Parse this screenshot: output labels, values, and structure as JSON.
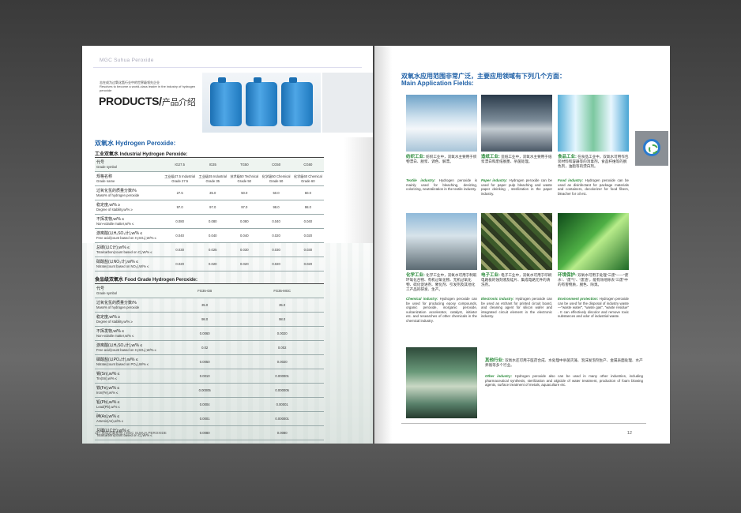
{
  "left_page": {
    "brand": "MGC Suhua Peroxide",
    "tagline_cn": "志在成为过氧化氢行业中的世界级领先企业",
    "tagline_en": "Resolves to become a world-class leader in the industry of hydrogen peroxide",
    "products_en": "PRODUCTS",
    "products_cn": "产品介绍",
    "heading": "双氧水 Hydrogen Peroxide:",
    "industrial_heading": "工业双氧水 Industrial Hydrogen Peroxide:",
    "food_heading": "食品级双氧水 Food Grade Hydrogen Peroxide:",
    "industrial_table": {
      "header_row1": {
        "cn": "代号",
        "en": "Grade symbol",
        "cells": [
          "IG27.5",
          "IG35",
          "TG50",
          "CG50",
          "CG60"
        ]
      },
      "header_row2": {
        "cn": "规格名称",
        "en": "Grade name",
        "cells": [
          "工业级27.5 Industrial Grade 27.5",
          "工业级35 Industrial Grade 35",
          "技术级50 Technical Grade 50",
          "化学级50 Chemical Grade 50",
          "化学级60 Chemical Grade 60"
        ]
      },
      "rows": [
        {
          "cn": "过氧化氢的质量分数/%",
          "en": "Mass% of hydrogen peroxide",
          "cells": [
            "27.5",
            "35.0",
            "50.0",
            "50.0",
            "60.0"
          ]
        },
        {
          "cn": "稳定度,w/% ≥",
          "en": "Degree of stability,w/% ≥",
          "cells": [
            "97.0",
            "97.0",
            "97.0",
            "98.0",
            "98.0"
          ]
        },
        {
          "cn": "不挥发物,w/% ≤",
          "en": "Non-volatile matter,w/% ≤",
          "cells": [
            "0.080",
            "0.080",
            "0.080",
            "0.040",
            "0.040"
          ]
        },
        {
          "cn": "游离酸(以H₂SO₄计),w/% ≤",
          "en": "Free acid(count based on H₂SO₄),W/% ≤",
          "cells": [
            "0.040",
            "0.040",
            "0.040",
            "0.020",
            "0.020"
          ]
        },
        {
          "cn": "总碳(以C计),w/% ≤",
          "en": "Totalcarbon(count based on C),W/% ≤",
          "cells": [
            "0.030",
            "0.025",
            "0.030",
            "0.030",
            "0.030"
          ]
        },
        {
          "cn": "硝酸盐(以NO₃计),w/% ≤",
          "en": "Nitrate(count based on NO₃),W/% ≤",
          "cells": [
            "0.020",
            "0.020",
            "0.020",
            "0.020",
            "0.020"
          ]
        }
      ]
    },
    "food_table": {
      "header": {
        "cn": "代号",
        "en": "Grade symbol",
        "cells": [
          "FG35-GB",
          "FG35-MGC"
        ]
      },
      "rows": [
        {
          "cn": "过氧化氢的质量分数/%",
          "en": "Mass% of hydrogen peroxide",
          "cells": [
            "35.0",
            "35.0"
          ]
        },
        {
          "cn": "稳定度,w/% ≥",
          "en": "Degree of stability,w/% ≥",
          "cells": [
            "98.0",
            "98.0"
          ]
        },
        {
          "cn": "不挥发物,w/% ≤",
          "en": "Non-volatile matter,w/% ≤",
          "cells": [
            "0.0060",
            "0.0020"
          ]
        },
        {
          "cn": "游离酸(以H₂SO₄计),w/% ≤",
          "en": "Free acid(count based on H₂SO₄),W/% ≤",
          "cells": [
            "0.02",
            "0.002"
          ]
        },
        {
          "cn": "磷酸盐(以PO₄计),w/% ≤",
          "en": "Nitrate(count based on PO₄),W/% ≤",
          "cells": [
            "0.0050",
            "0.0020"
          ]
        },
        {
          "cn": "锡(Sn),w/% ≤",
          "en": "Tin(Sn),w/% ≤",
          "cells": [
            "0.0010",
            "0.000001"
          ]
        },
        {
          "cn": "铁(Fe),w/% ≤",
          "en": "Iron(Fe),w/% ≤",
          "cells": [
            "0.00005",
            "0.000005"
          ]
        },
        {
          "cn": "铅(Pb),w/% ≤",
          "en": "Lead(Pb),w/% ≤",
          "cells": [
            "0.0004",
            "0.00001"
          ]
        },
        {
          "cn": "砷(As),w/% ≤",
          "en": "Arsenic(As),w/% ≤",
          "cells": [
            "0.0001",
            "0.000001"
          ]
        },
        {
          "cn": "总碳(以C计),w/% ≤",
          "en": "Totalcarbon(count based on C),W/% ≤",
          "cells": [
            "0.0080",
            "0.0080"
          ]
        }
      ]
    },
    "page_number": "11",
    "footer": "| 苏华过氧化物 | MGC SUHUA PEROXIDE"
  },
  "right_page": {
    "title_cn": "双氧水应用范围非常广泛，主要应用领域有下列几个方面：",
    "title_en": "Main Application Fields:",
    "apps": [
      {
        "head": "纺织工业:",
        "cn": "纺织工业中，双氧水主要用于织物漂白、脱浆、调色、解漂。",
        "en_head": "Textile industry:",
        "en": "Hydrogen peroxide is mainly used for bleaching, desizing, colorizing, neutralization in the textile industry."
      },
      {
        "head": "造纸工业:",
        "cn": "造纸工业中，双氧水主要用于纸浆漂白和废纸脱墨、杀菌处理。",
        "en_head": "Paper industry:",
        "en": "Hydrogen peroxide can be used for paper pulp bleaching and waste paper deinking , sterilization in the paper industry."
      },
      {
        "head": "食品工业:",
        "cn": "在食品工业中，双氧水可用作包装材料和容器等的消毒剂，食品杆维等的脱色剂，油脂等的漂白剂。",
        "en_head": "Food industry:",
        "en": "Hydrogen peroxide can be used as disinfectant for package materials and containers, decolorizer for food fibers, bleacher for oil etc."
      },
      {
        "head": "化学工业:",
        "cn": "化学工业中，双氧水可用于制取环氧化合物、有机过氧化物、无机过氧化物、硫化促进剂、催化剂、引发剂及其他化工产品的研发、生产。",
        "en_head": "Chemical industry:",
        "en": "Hydrogen peroxide can be used for producing epoxy compounds, organic peroxide, inorganic peroxide, vulcanization accelerator, catalyst, initiator etc. and researches of other chemicals in the chemical industry."
      },
      {
        "head": "电子工业:",
        "cn": "电子工业中，双氧水可用于印刷电路板的蚀刻液及硅片、集成电路元件的清洗剂。",
        "en_head": "Electronic industry:",
        "en": "Hydrogen peroxide can be used as etchant for printed circuit board, and cleaning agent for silicon wafer and integrated circuit element in the electronic industry."
      },
      {
        "head": "环境保护:",
        "cn": "双氧水可用于处理“三废”——“废水”、“废气”、“废渣”，能有效地除去“三废”中的有害物质，脱色、除臭。",
        "en_head": "Environment protection:",
        "en": "Hydrogen peroxide can be used for the disposal of industry waste—\"waste water\", \"waste gas\", \"waste residue\" . It can effectively discolor and remove toxic substances and odor of industrial waste."
      }
    ],
    "other": {
      "head": "其他行业:",
      "cn": "双氧水还可用于医药合成、水处理中杀菌灭藻、泡沫发泡剂生产、金属表面处理、水产养殖等多个行业。",
      "en_head": "Other industry:",
      "en": "Hydrogen peroxide also can be used in many other industries, including pharmaceutical synthesis, sterilization and algicide of water treatment, production of foam blowing agents, surface treatment of metals, aquaculture etc."
    },
    "page_number": "12"
  }
}
